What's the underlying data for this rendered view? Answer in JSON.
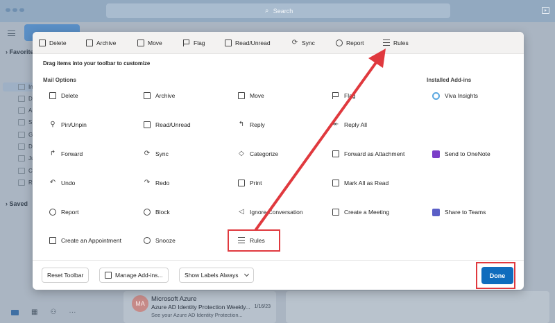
{
  "titlebar": {
    "search_placeholder": "Search"
  },
  "nav": {
    "favorites": "Favorites",
    "saved": "Saved",
    "letters": [
      "In",
      "D",
      "A",
      "S",
      "G",
      "D",
      "Ju",
      "C",
      "R"
    ]
  },
  "message": {
    "avatar": "MA",
    "sender": "Microsoft Azure",
    "subject": "Azure AD Identity Protection Weekly...",
    "date": "1/16/23",
    "preview": "See your Azure AD Identity Protection..."
  },
  "toolbar": {
    "items": [
      "Delete",
      "Archive",
      "Move",
      "Flag",
      "Read/Unread",
      "Sync",
      "Report",
      "Rules"
    ]
  },
  "dialog": {
    "hint": "Drag items into your toolbar to customize",
    "mail_options_label": "Mail Options",
    "addins_label": "Installed Add-ins"
  },
  "options": {
    "col1": [
      "Delete",
      "Pin/Unpin",
      "Forward",
      "Undo",
      "Report",
      "Create an Appointment"
    ],
    "col2": [
      "Archive",
      "Read/Unread",
      "Sync",
      "Redo",
      "Block",
      "Snooze"
    ],
    "col3": [
      "Move",
      "Reply",
      "Categorize",
      "Print",
      "Ignore Conversation",
      "Rules"
    ],
    "col4": [
      "Flag",
      "Reply All",
      "Forward as Attachment",
      "Mark All as Read",
      "Create a Meeting"
    ],
    "addins": [
      "Viva Insights",
      "Send to OneNote",
      "Share to Teams"
    ]
  },
  "footer": {
    "reset": "Reset Toolbar",
    "manage": "Manage Add-ins...",
    "labels": "Show Labels Always",
    "done": "Done"
  },
  "colors": {
    "accent": "#0f6cbd",
    "callout": "#e0393e"
  }
}
